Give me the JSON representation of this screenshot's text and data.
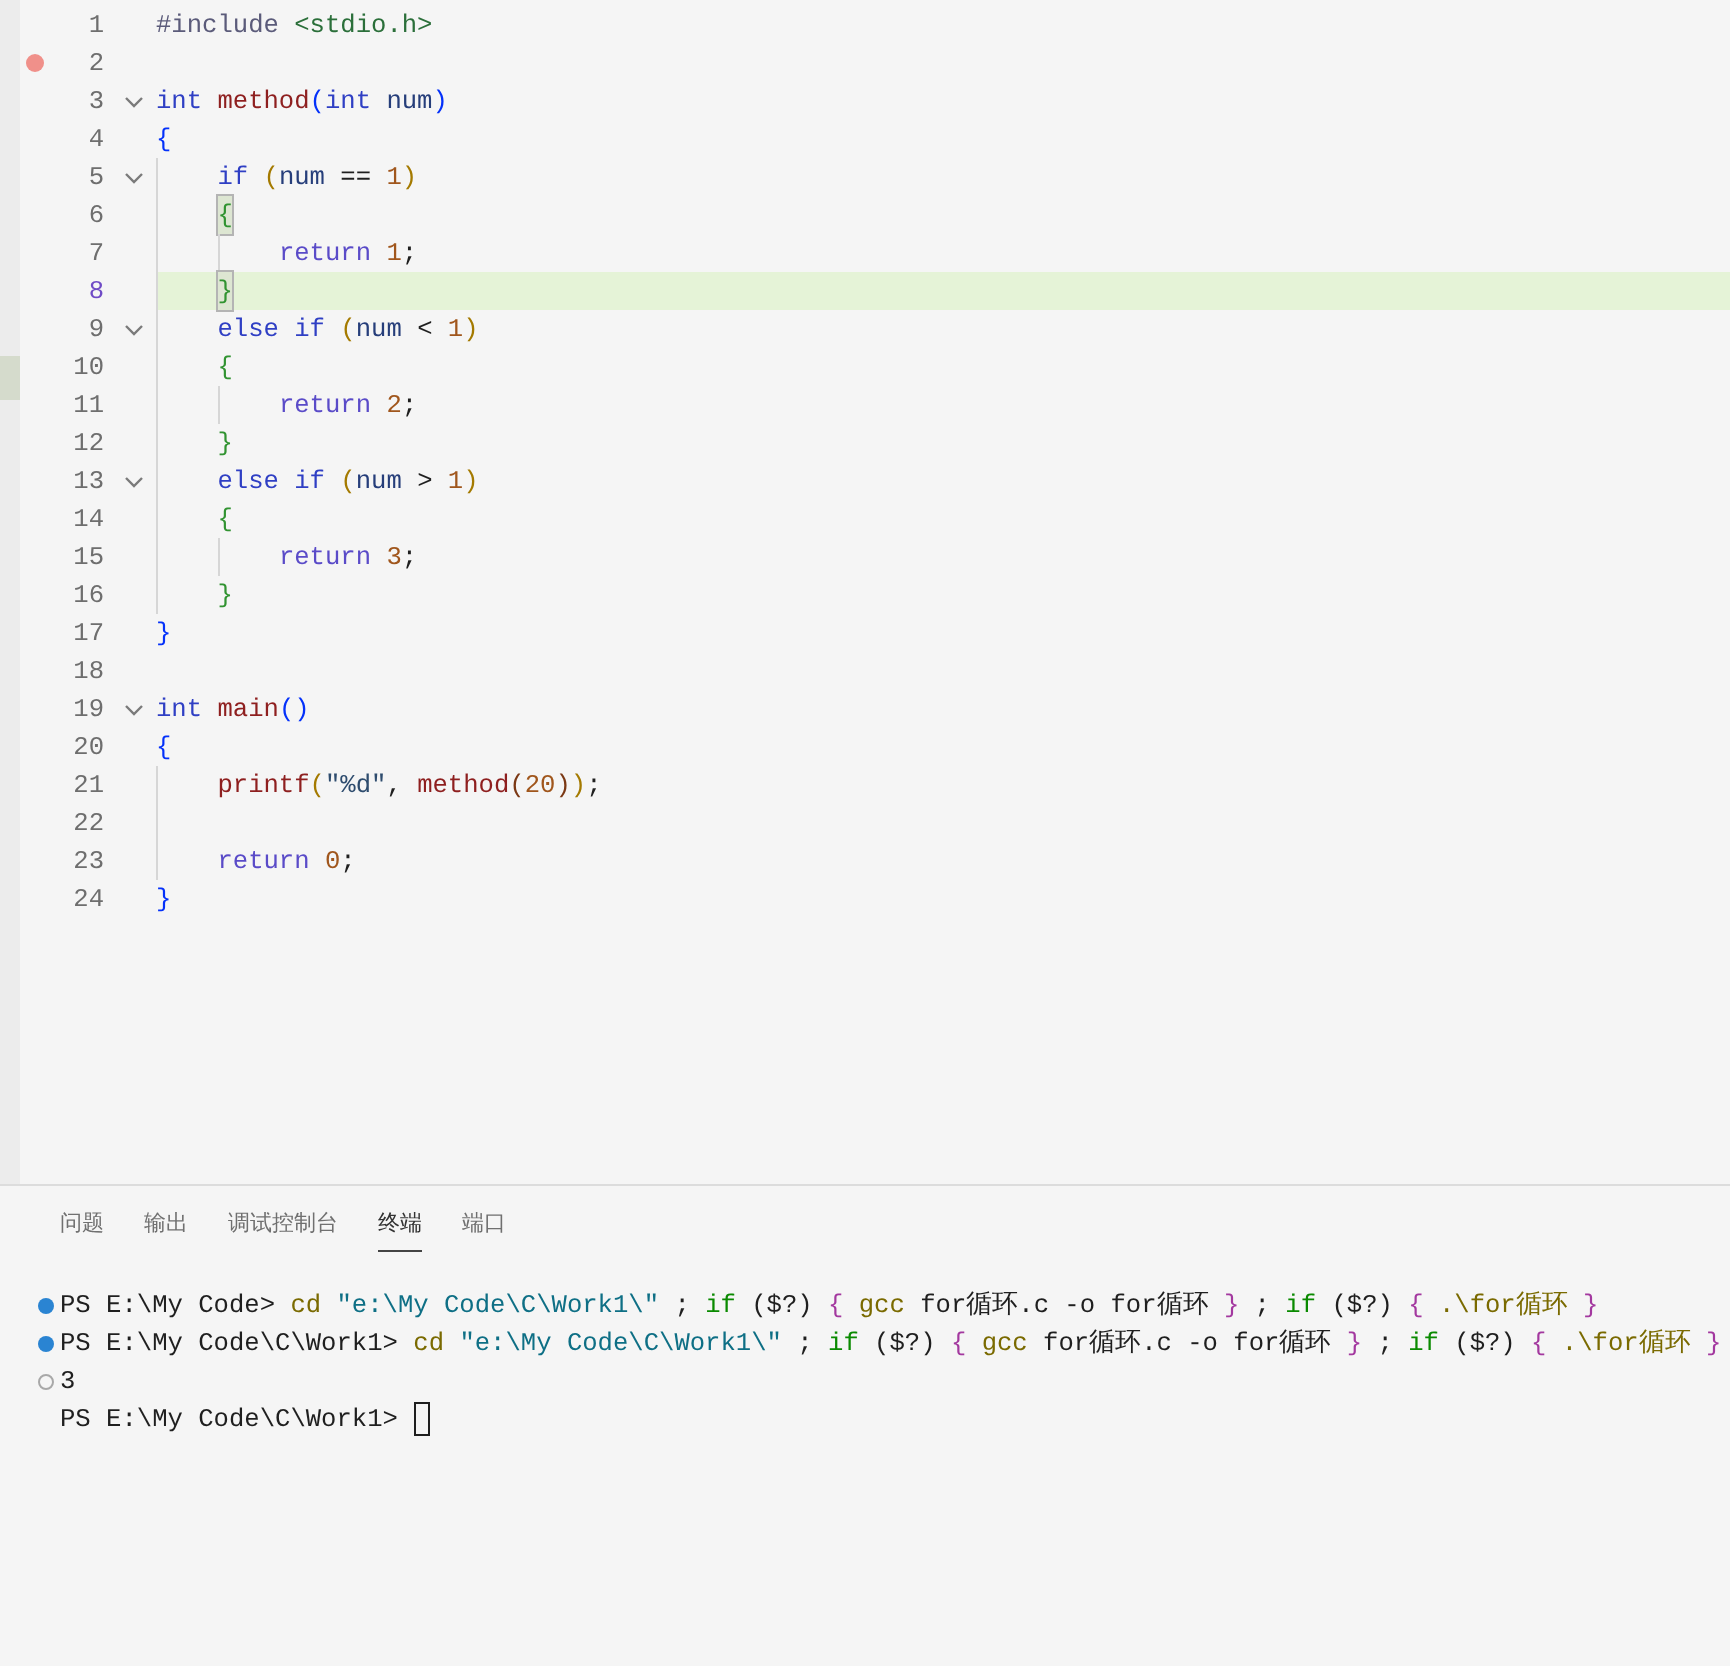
{
  "editor": {
    "lines": [
      {
        "number": "1",
        "foldable": false,
        "breakpoint": false,
        "highlighted": false,
        "tokens": [
          {
            "text": "#include ",
            "kind": "preproc"
          },
          {
            "text": "<stdio.h>",
            "kind": "header"
          }
        ]
      },
      {
        "number": "2",
        "foldable": false,
        "breakpoint": true,
        "highlighted": false
      },
      {
        "number": "3",
        "foldable": true,
        "breakpoint": false,
        "highlighted": false,
        "tokens": [
          {
            "text": "int ",
            "kind": "type"
          },
          {
            "text": "method",
            "kind": "func"
          },
          {
            "text": "(",
            "kind": "depth1"
          },
          {
            "text": "int ",
            "kind": "type"
          },
          {
            "text": "num",
            "kind": "param"
          },
          {
            "text": ")",
            "kind": "depth1"
          }
        ]
      },
      {
        "number": "4",
        "foldable": false,
        "breakpoint": false,
        "highlighted": false,
        "tokens": [
          {
            "text": "{",
            "kind": "depth1"
          }
        ],
        "children": [
          {
            "number": "5",
            "foldable": true,
            "breakpoint": false,
            "highlighted": false,
            "tokens": [
              {
                "text": "if ",
                "kind": "keyword"
              },
              {
                "text": "(",
                "kind": "depth2"
              },
              {
                "text": "num ",
                "kind": "param"
              },
              {
                "text": "== ",
                "kind": "plain"
              },
              {
                "text": "1",
                "kind": "number"
              },
              {
                "text": ")",
                "kind": "depth2"
              }
            ]
          },
          {
            "number": "6",
            "foldable": false,
            "breakpoint": false,
            "highlighted": false,
            "tokens": [
              {
                "text": "{",
                "kind": "brace",
                "matched": true
              }
            ],
            "children": [
              {
                "number": "7",
                "foldable": false,
                "breakpoint": false,
                "highlighted": false,
                "tokens": [
                  {
                    "text": "return ",
                    "kind": "control"
                  },
                  {
                    "text": "1",
                    "kind": "number"
                  },
                  {
                    "text": ";",
                    "kind": "plain"
                  }
                ]
              }
            ]
          },
          {
            "number": "8",
            "foldable": false,
            "breakpoint": false,
            "highlighted": true,
            "tokens": [
              {
                "text": "}",
                "kind": "brace",
                "matched": true
              }
            ]
          },
          {
            "number": "9",
            "foldable": true,
            "breakpoint": false,
            "highlighted": false,
            "tokens": [
              {
                "text": "else if ",
                "kind": "keyword"
              },
              {
                "text": "(",
                "kind": "depth2"
              },
              {
                "text": "num ",
                "kind": "param"
              },
              {
                "text": "< ",
                "kind": "plain"
              },
              {
                "text": "1",
                "kind": "number"
              },
              {
                "text": ")",
                "kind": "depth2"
              }
            ]
          },
          {
            "number": "10",
            "foldable": false,
            "breakpoint": false,
            "highlighted": false,
            "tokens": [
              {
                "text": "{",
                "kind": "brace",
                "matched": false
              }
            ],
            "children": [
              {
                "number": "11",
                "foldable": false,
                "breakpoint": false,
                "highlighted": false,
                "tokens": [
                  {
                    "text": "return ",
                    "kind": "control"
                  },
                  {
                    "text": "2",
                    "kind": "number"
                  },
                  {
                    "text": ";",
                    "kind": "plain"
                  }
                ]
              }
            ]
          },
          {
            "number": "12",
            "foldable": false,
            "breakpoint": false,
            "highlighted": false,
            "tokens": [
              {
                "text": "}",
                "kind": "brace",
                "matched": false
              }
            ]
          },
          {
            "number": "13",
            "foldable": true,
            "breakpoint": false,
            "highlighted": false,
            "tokens": [
              {
                "text": "else if ",
                "kind": "keyword"
              },
              {
                "text": "(",
                "kind": "depth2"
              },
              {
                "text": "num ",
                "kind": "param"
              },
              {
                "text": "> ",
                "kind": "plain"
              },
              {
                "text": "1",
                "kind": "number"
              },
              {
                "text": ")",
                "kind": "depth2"
              }
            ]
          },
          {
            "number": "14",
            "foldable": false,
            "breakpoint": false,
            "highlighted": false,
            "tokens": [
              {
                "text": "{",
                "kind": "brace",
                "matched": false
              }
            ],
            "children": [
              {
                "number": "15",
                "foldable": false,
                "breakpoint": false,
                "highlighted": false,
                "tokens": [
                  {
                    "text": "return ",
                    "kind": "control"
                  },
                  {
                    "text": "3",
                    "kind": "number"
                  },
                  {
                    "text": ";",
                    "kind": "plain"
                  }
                ]
              }
            ]
          },
          {
            "number": "16",
            "foldable": false,
            "breakpoint": false,
            "highlighted": false,
            "tokens": [
              {
                "text": "}",
                "kind": "brace",
                "matched": false
              }
            ]
          }
        ]
      },
      {
        "number": "17",
        "foldable": false,
        "breakpoint": false,
        "highlighted": false,
        "tokens": [
          {
            "text": "}",
            "kind": "depth1"
          }
        ]
      },
      {
        "number": "18",
        "foldable": false,
        "breakpoint": false,
        "highlighted": false
      },
      {
        "number": "19",
        "foldable": true,
        "breakpoint": false,
        "highlighted": false,
        "tokens": [
          {
            "text": "int ",
            "kind": "type"
          },
          {
            "text": "main",
            "kind": "func"
          },
          {
            "text": "()",
            "kind": "depth1"
          }
        ]
      },
      {
        "number": "20",
        "foldable": false,
        "breakpoint": false,
        "highlighted": false,
        "tokens": [
          {
            "text": "{",
            "kind": "depth1"
          }
        ],
        "children": [
          {
            "number": "21",
            "foldable": false,
            "breakpoint": false,
            "highlighted": false,
            "tokens": [
              {
                "text": "printf",
                "kind": "func"
              },
              {
                "text": "(",
                "kind": "depth2"
              },
              {
                "text": "\"%d\"",
                "kind": "string"
              },
              {
                "text": ", ",
                "kind": "plain"
              },
              {
                "text": "method",
                "kind": "func"
              },
              {
                "text": "(",
                "kind": "depth3"
              },
              {
                "text": "20",
                "kind": "number"
              },
              {
                "text": ")",
                "kind": "depth3"
              },
              {
                "text": ")",
                "kind": "depth2"
              },
              {
                "text": ";",
                "kind": "plain"
              }
            ]
          },
          {
            "number": "22",
            "foldable": false,
            "breakpoint": false,
            "highlighted": false
          },
          {
            "number": "23",
            "foldable": false,
            "breakpoint": false,
            "highlighted": false,
            "tokens": [
              {
                "text": "return ",
                "kind": "control"
              },
              {
                "text": "0",
                "kind": "number"
              },
              {
                "text": ";",
                "kind": "plain"
              }
            ]
          }
        ]
      },
      {
        "number": "24",
        "foldable": false,
        "breakpoint": false,
        "highlighted": false,
        "tokens": [
          {
            "text": "}",
            "kind": "depth1"
          }
        ]
      }
    ]
  },
  "panel": {
    "tabs": [
      {
        "label": "问题",
        "selected": false
      },
      {
        "label": "输出",
        "selected": false
      },
      {
        "label": "调试控制台",
        "selected": false
      },
      {
        "label": "终端",
        "selected": true
      },
      {
        "label": "端口",
        "selected": false
      }
    ],
    "terminal": {
      "lines": [
        {
          "kind": "command",
          "segments": [
            {
              "text": "PS E:\\My Code> ",
              "kind": "plain"
            },
            {
              "text": "cd ",
              "kind": "command"
            },
            {
              "text": "\"e:\\My Code\\C\\Work1\\\"",
              "kind": "string"
            },
            {
              "text": " ; ",
              "kind": "plain"
            },
            {
              "text": "if",
              "kind": "keyword"
            },
            {
              "text": " ($?) ",
              "kind": "plain"
            },
            {
              "text": "{ ",
              "kind": "brace"
            },
            {
              "text": "gcc",
              "kind": "command"
            },
            {
              "text": " for循环.c -o for循环 ",
              "kind": "plain"
            },
            {
              "text": "}",
              "kind": "brace"
            },
            {
              "text": " ; ",
              "kind": "plain"
            },
            {
              "text": "if",
              "kind": "keyword"
            },
            {
              "text": " ($?) ",
              "kind": "plain"
            },
            {
              "text": "{ ",
              "kind": "brace"
            },
            {
              "text": ".\\for循环",
              "kind": "command"
            },
            {
              "text": " }",
              "kind": "brace"
            }
          ]
        },
        {
          "kind": "command",
          "segments": [
            {
              "text": "PS E:\\My Code\\C\\Work1> ",
              "kind": "plain"
            },
            {
              "text": "cd ",
              "kind": "command"
            },
            {
              "text": "\"e:\\My Code\\C\\Work1\\\"",
              "kind": "string"
            },
            {
              "text": " ; ",
              "kind": "plain"
            },
            {
              "text": "if",
              "kind": "keyword"
            },
            {
              "text": " ($?) ",
              "kind": "plain"
            },
            {
              "text": "{ ",
              "kind": "brace"
            },
            {
              "text": "gcc",
              "kind": "command"
            },
            {
              "text": " for循环.c -o for循环 ",
              "kind": "plain"
            },
            {
              "text": "}",
              "kind": "brace"
            },
            {
              "text": " ; ",
              "kind": "plain"
            },
            {
              "text": "if",
              "kind": "keyword"
            },
            {
              "text": " ($?) ",
              "kind": "plain"
            },
            {
              "text": "{ ",
              "kind": "brace"
            },
            {
              "text": ".\\for循环",
              "kind": "command"
            },
            {
              "text": " }",
              "kind": "brace"
            }
          ]
        },
        {
          "kind": "output",
          "segments": [
            {
              "text": "3",
              "kind": "plain"
            }
          ]
        },
        {
          "kind": "prompt",
          "cursor": true,
          "segments": [
            {
              "text": "PS E:\\My Code\\C\\Work1> ",
              "kind": "plain"
            }
          ]
        }
      ]
    }
  }
}
